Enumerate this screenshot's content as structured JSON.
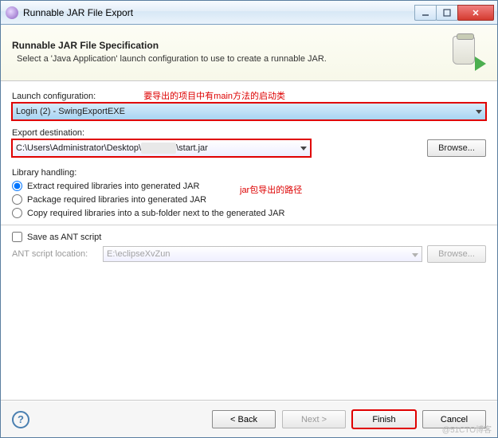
{
  "window": {
    "title": "Runnable JAR File Export"
  },
  "banner": {
    "title": "Runnable JAR File Specification",
    "desc": "Select a 'Java Application' launch configuration to use to create a runnable JAR."
  },
  "annotations": {
    "launch": "要导出的项目中有main方法的启动类",
    "dest": "jar包导出的路径"
  },
  "labels": {
    "launch_config": "Launch configuration:",
    "export_dest": "Export destination:",
    "library_handling": "Library handling:",
    "browse": "Browse...",
    "save_ant": "Save as ANT script",
    "ant_loc": "ANT script location:"
  },
  "launch": {
    "value": "Login (2) - SwingExportEXE"
  },
  "destination": {
    "prefix": "C:\\Users\\Administrator\\Desktop\\",
    "suffix": "\\start.jar"
  },
  "library": {
    "opt1": "Extract required libraries into generated JAR",
    "opt2": "Package required libraries into generated JAR",
    "opt3": "Copy required libraries into a sub-folder next to the generated JAR"
  },
  "ant": {
    "location": "E:\\eclipseXvZun"
  },
  "buttons": {
    "back": "< Back",
    "next": "Next >",
    "finish": "Finish",
    "cancel": "Cancel"
  },
  "watermark": "@51CTO博客"
}
